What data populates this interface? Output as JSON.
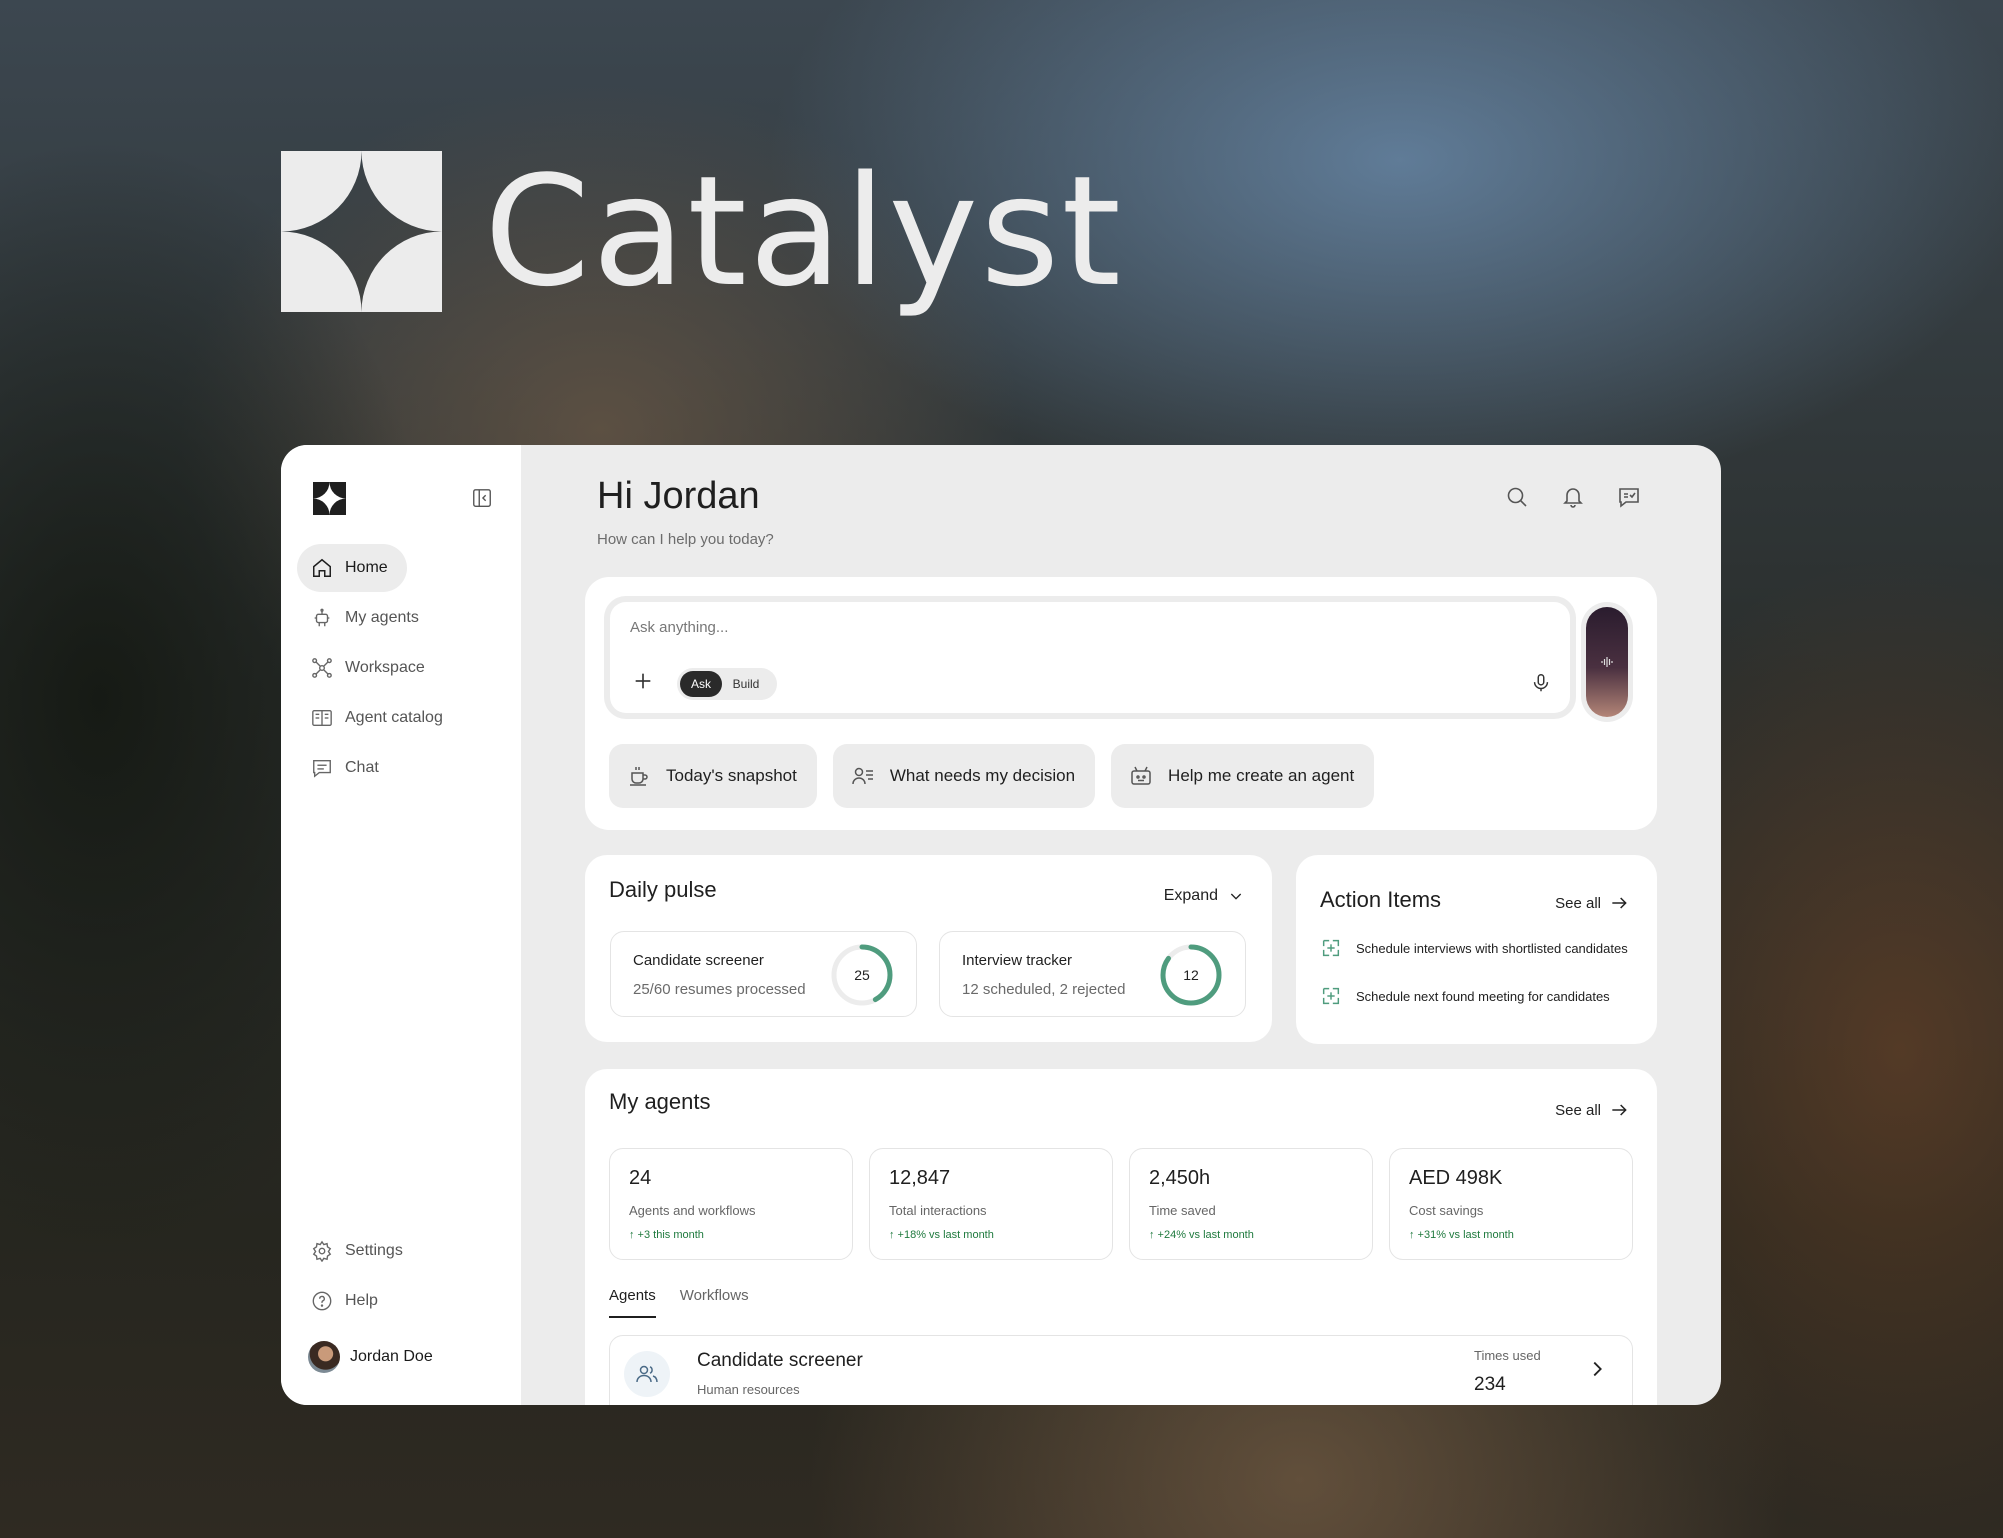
{
  "brand": {
    "name": "Catalyst",
    "logo_icon": "catalyst-logo-icon"
  },
  "sidebar": {
    "items": [
      {
        "label": "Home",
        "icon": "home-icon"
      },
      {
        "label": "My agents",
        "icon": "robot-icon"
      },
      {
        "label": "Workspace",
        "icon": "network-icon"
      },
      {
        "label": "Agent catalog",
        "icon": "catalog-icon"
      },
      {
        "label": "Chat",
        "icon": "chat-icon"
      }
    ],
    "bottom_items": [
      {
        "label": "Settings",
        "icon": "gear-icon"
      },
      {
        "label": "Help",
        "icon": "help-icon"
      }
    ],
    "user": {
      "name": "Jordan Doe"
    }
  },
  "header": {
    "greeting": "Hi Jordan",
    "subtitle": "How can I help you today?"
  },
  "ask": {
    "placeholder": "Ask anything...",
    "mode_ask": "Ask",
    "mode_build": "Build",
    "active_mode": "Ask",
    "chips": [
      {
        "label": "Today's snapshot",
        "icon": "coffee-icon"
      },
      {
        "label": "What needs my decision",
        "icon": "person-list-icon"
      },
      {
        "label": "Help me create an agent",
        "icon": "bot-icon"
      }
    ]
  },
  "pulse": {
    "title": "Daily pulse",
    "expand_label": "Expand",
    "metrics": [
      {
        "title": "Candidate screener",
        "desc": "25/60 resumes processed",
        "value": "25",
        "progress": 0.42
      },
      {
        "title": "Interview tracker",
        "desc": "12 scheduled, 2 rejected",
        "value": "12",
        "progress": 0.85
      }
    ]
  },
  "actions": {
    "title": "Action Items",
    "see_all": "See all",
    "items": [
      "Schedule interviews with shortlisted candidates",
      "Schedule next found meeting for candidates"
    ]
  },
  "agents": {
    "title": "My agents",
    "see_all": "See all",
    "stats": [
      {
        "value": "24",
        "label": "Agents and workflows",
        "change": "↑ +3 this month"
      },
      {
        "value": "12,847",
        "label": "Total interactions",
        "change": "↑ +18% vs last month"
      },
      {
        "value": "2,450h",
        "label": "Time saved",
        "change": "↑ +24% vs last month"
      },
      {
        "value": "AED 498K",
        "label": "Cost savings",
        "change": "↑ +31% vs last month"
      }
    ],
    "tabs": [
      "Agents",
      "Workflows"
    ],
    "active_tab": "Agents",
    "rows": [
      {
        "name": "Candidate screener",
        "category": "Human resources",
        "times_used_label": "Times used",
        "times_used": "234"
      }
    ]
  },
  "colors": {
    "accent_green": "#4f9c7e",
    "fab_logo": "#9fe02a",
    "change_green": "#1f7a3e"
  }
}
